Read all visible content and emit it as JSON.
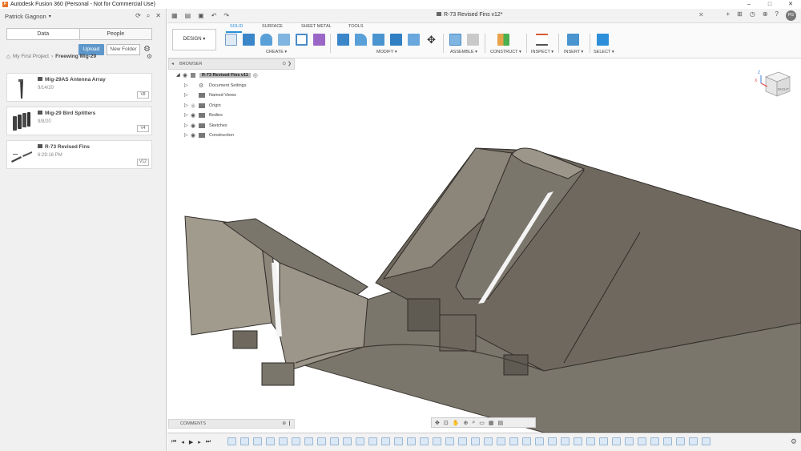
{
  "window": {
    "app_logo": "F",
    "title": "Autodesk Fusion 360 (Personal - Not for Commercial Use)",
    "minimize": "–",
    "maximize": "□",
    "close": "✕"
  },
  "data_panel": {
    "user": "Patrick Gagnon",
    "tabs": [
      "Data",
      "People"
    ],
    "upload_label": "Upload",
    "new_folder_label": "New Folder",
    "breadcrumb": [
      "My First Project",
      "Freewing Mig-29"
    ],
    "items": [
      {
        "title": "Mig-29AS Antenna Array",
        "date": "9/14/20",
        "version": "V8"
      },
      {
        "title": "Mig-29 Bird Splitters",
        "date": "9/8/20",
        "version": "V4"
      },
      {
        "title": "R-73 Revised Fins",
        "date": "6:29:16 PM",
        "version": "V12"
      }
    ]
  },
  "document": {
    "tab_title": "R-73 Revised Fins v12*",
    "user_initials": "PG"
  },
  "ribbon": {
    "workspace": "DESIGN",
    "tabs": [
      "SOLID",
      "SURFACE",
      "SHEET METAL",
      "TOOLS"
    ],
    "groups": [
      "CREATE",
      "MODIFY",
      "ASSEMBLE",
      "CONSTRUCT",
      "INSPECT",
      "INSERT",
      "SELECT"
    ]
  },
  "browser": {
    "title": "BROWSER",
    "root": "R-73 Revised Fins v11",
    "nodes": [
      "Document Settings",
      "Named Views",
      "Origin",
      "Bodies",
      "Sketches",
      "Construction"
    ]
  },
  "viewcube": {
    "face": "RIGHT",
    "axis_x": "X",
    "axis_z": "Z"
  },
  "comments": {
    "title": "COMMENTS"
  },
  "colors": {
    "accent": "#2d8fd9",
    "upload": "#5e97c9",
    "model": "#6e685e"
  }
}
